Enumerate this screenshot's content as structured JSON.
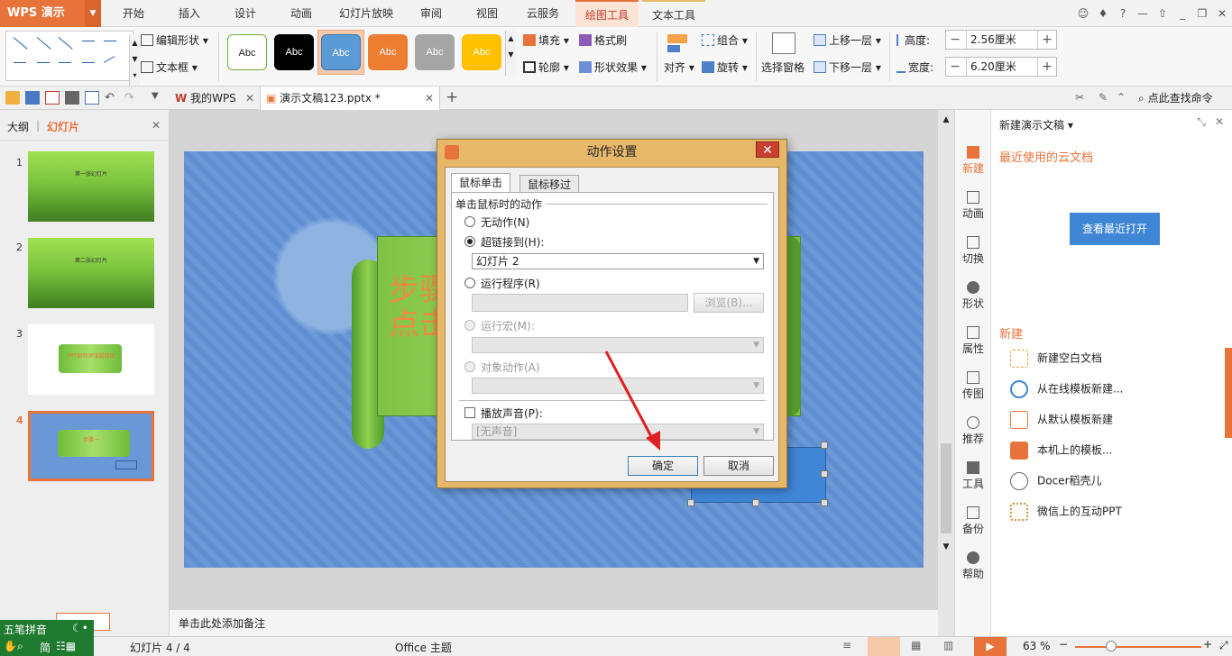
{
  "app": {
    "name": "WPS 演示"
  },
  "menu_tabs": [
    "开始",
    "插入",
    "设计",
    "动画",
    "幻灯片放映",
    "审阅",
    "视图",
    "云服务",
    "绘图工具",
    "文本工具"
  ],
  "ribbon": {
    "edit_shape": "编辑形状",
    "text_box": "文本框",
    "style_label": "Abc",
    "fill": "填充",
    "format_painter": "格式刷",
    "outline": "轮廓",
    "shape_effects": "形状效果",
    "align": "对齐",
    "group": "组合",
    "rotate": "旋转",
    "selection_pane": "选择窗格",
    "bring_forward": "上移一层",
    "send_backward": "下移一层",
    "height_label": "高度:",
    "height_value": "2.56厘米",
    "width_label": "宽度:",
    "width_value": "6.20厘米"
  },
  "quickbar": {
    "tab_mywps": "我的WPS",
    "tab_doc": "演示文稿123.pptx *",
    "search_cmd": "点此查找命令"
  },
  "left_panel": {
    "tab_outline": "大纲",
    "tab_slides": "幻灯片",
    "slides": [
      {
        "num": "1",
        "text": "第一张幻灯片"
      },
      {
        "num": "2",
        "text": "第二张幻灯片"
      },
      {
        "num": "3",
        "text": "PPT如何添加超链接"
      },
      {
        "num": "4",
        "text": "步骤一"
      }
    ]
  },
  "notes_placeholder": "单击此处添加备注",
  "slide_text": {
    "line1": "步骤",
    "line2": "点击"
  },
  "dialog": {
    "title": "动作设置",
    "tab_click": "鼠标单击",
    "tab_hover": "鼠标移过",
    "group_label": "单击鼠标时的动作",
    "opt_none": "无动作(N)",
    "opt_hyperlink": "超链接到(H):",
    "hyperlink_value": "幻灯片 2",
    "opt_run_program": "运行程序(R)",
    "browse": "浏览(B)...",
    "opt_run_macro": "运行宏(M):",
    "opt_object_action": "对象动作(A)",
    "play_sound": "播放声音(P):",
    "sound_value": "[无声音]",
    "ok": "确定",
    "cancel": "取消"
  },
  "task_pane": {
    "title": "新建演示文稿",
    "recent_cloud": "最近使用的云文档",
    "view_recent": "查看最近打开",
    "new_header": "新建",
    "side_items": [
      "新建",
      "动画",
      "切换",
      "形状",
      "属性",
      "传图",
      "推荐",
      "工具",
      "备份",
      "帮助"
    ],
    "list": [
      "新建空白文档",
      "从在线模板新建...",
      "从默认模板新建",
      "本机上的模板...",
      "Docer稻壳儿",
      "微信上的互动PPT"
    ]
  },
  "statusbar": {
    "slide_info": "幻灯片 4 / 4",
    "theme": "Office 主题",
    "zoom": "63 %"
  },
  "ime": {
    "name": "五笔拼音",
    "mode": "简"
  },
  "colors": {
    "accent": "#e8733a",
    "dialog_frame": "#e8b86a",
    "pane_blue": "#3f86d6"
  }
}
